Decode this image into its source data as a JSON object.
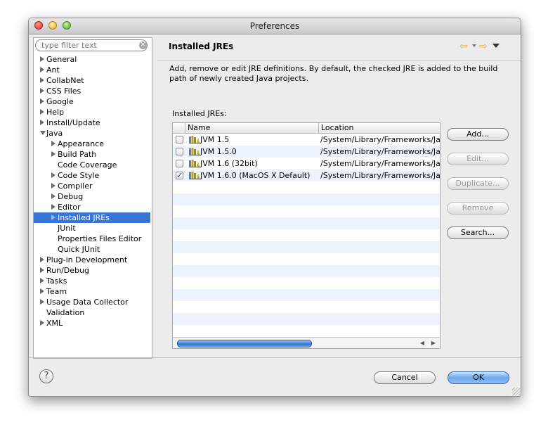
{
  "window": {
    "title": "Preferences"
  },
  "filter": {
    "placeholder": "type filter text",
    "clear_icon": "clear-icon"
  },
  "tree": [
    {
      "label": "General",
      "toggle": "closed",
      "depth": 0
    },
    {
      "label": "Ant",
      "toggle": "closed",
      "depth": 0
    },
    {
      "label": "CollabNet",
      "toggle": "closed",
      "depth": 0
    },
    {
      "label": "CSS Files",
      "toggle": "closed",
      "depth": 0
    },
    {
      "label": "Google",
      "toggle": "closed",
      "depth": 0
    },
    {
      "label": "Help",
      "toggle": "closed",
      "depth": 0
    },
    {
      "label": "Install/Update",
      "toggle": "closed",
      "depth": 0
    },
    {
      "label": "Java",
      "toggle": "open",
      "depth": 0
    },
    {
      "label": "Appearance",
      "toggle": "closed",
      "depth": 1
    },
    {
      "label": "Build Path",
      "toggle": "closed",
      "depth": 1
    },
    {
      "label": "Code Coverage",
      "toggle": "none",
      "depth": 1
    },
    {
      "label": "Code Style",
      "toggle": "closed",
      "depth": 1
    },
    {
      "label": "Compiler",
      "toggle": "closed",
      "depth": 1
    },
    {
      "label": "Debug",
      "toggle": "closed",
      "depth": 1
    },
    {
      "label": "Editor",
      "toggle": "closed",
      "depth": 1
    },
    {
      "label": "Installed JREs",
      "toggle": "closed",
      "depth": 1,
      "selected": true
    },
    {
      "label": "JUnit",
      "toggle": "none",
      "depth": 1
    },
    {
      "label": "Properties Files Editor",
      "toggle": "none",
      "depth": 1
    },
    {
      "label": "Quick JUnit",
      "toggle": "none",
      "depth": 1
    },
    {
      "label": "Plug-in Development",
      "toggle": "closed",
      "depth": 0
    },
    {
      "label": "Run/Debug",
      "toggle": "closed",
      "depth": 0
    },
    {
      "label": "Tasks",
      "toggle": "closed",
      "depth": 0
    },
    {
      "label": "Team",
      "toggle": "closed",
      "depth": 0
    },
    {
      "label": "Usage Data Collector",
      "toggle": "closed",
      "depth": 0
    },
    {
      "label": "Validation",
      "toggle": "none",
      "depth": 0
    },
    {
      "label": "XML",
      "toggle": "closed",
      "depth": 0
    }
  ],
  "page": {
    "title": "Installed JREs",
    "description": "Add, remove or edit JRE definitions. By default, the checked JRE is added to the build path of newly created Java projects.",
    "list_label": "Installed JREs:",
    "nav": {
      "back_icon": "back-arrow-icon",
      "forward_icon": "forward-arrow-icon",
      "menu_icon": "view-menu-icon"
    }
  },
  "table": {
    "columns": [
      "Name",
      "Location"
    ],
    "rows": [
      {
        "name": "JVM 1.5",
        "location": "/System/Library/Frameworks/JavaVM.framework",
        "checked": false
      },
      {
        "name": "JVM 1.5.0",
        "location": "/System/Library/Frameworks/JavaVM.framework",
        "checked": false
      },
      {
        "name": "JVM 1.6 (32bit)",
        "location": "/System/Library/Frameworks/JavaVM.framework",
        "checked": false
      },
      {
        "name": "JVM 1.6.0 (MacOS X Default)",
        "location": "/System/Library/Frameworks/JavaVM.framework",
        "checked": true
      }
    ],
    "empty_rows": 13,
    "row_icon": "jre-library-icon",
    "scroll_left": "◀",
    "scroll_right": "▶"
  },
  "buttons": {
    "add": "Add...",
    "edit": "Edit...",
    "duplicate": "Duplicate...",
    "remove": "Remove",
    "search": "Search..."
  },
  "footer": {
    "help": "?",
    "cancel": "Cancel",
    "ok": "OK"
  },
  "colors": {
    "selection": "#3875d7",
    "alt_row": "#edf3fe",
    "ok_button": "#6aa6ee"
  }
}
